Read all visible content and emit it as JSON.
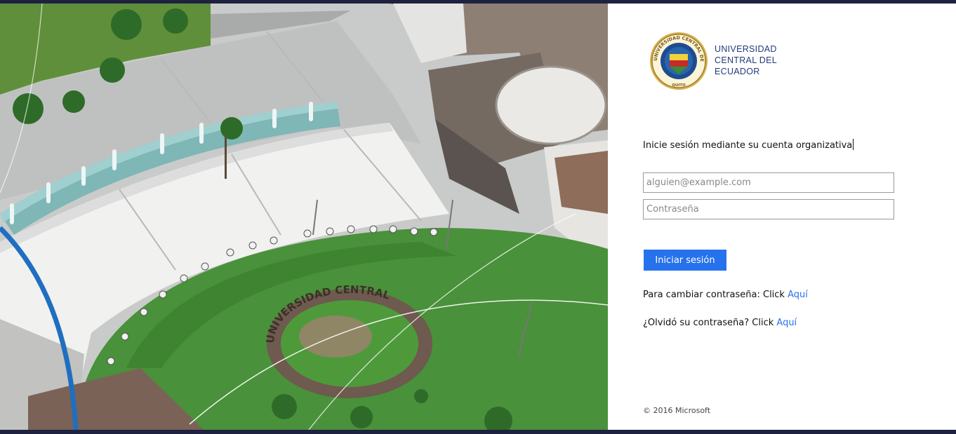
{
  "brand": {
    "line1": "UNIVERSIDAD",
    "line2": "CENTRAL DEL",
    "line3": "ECUADOR",
    "seal_text": "UNIVERSIDAD CENTRAL DEL ECUADOR",
    "seal_city": "QUITO",
    "color": "#233a7c"
  },
  "login": {
    "prompt": "Inicie sesión mediante su cuenta organizativa",
    "email_placeholder": "alguien@example.com",
    "password_placeholder": "Contraseña",
    "signin_label": "Iniciar sesión",
    "change_text": "Para cambiar contraseña: Click ",
    "change_link": "Aquí",
    "forgot_text": "¿Olvidó su contraseña? Click ",
    "forgot_link": "Aquí",
    "accent_color": "#2672ec"
  },
  "footer": {
    "copyright": "© 2016 Microsoft"
  },
  "illustration": {
    "ground_lettering": "UNIVERSIDAD CENTRAL"
  }
}
